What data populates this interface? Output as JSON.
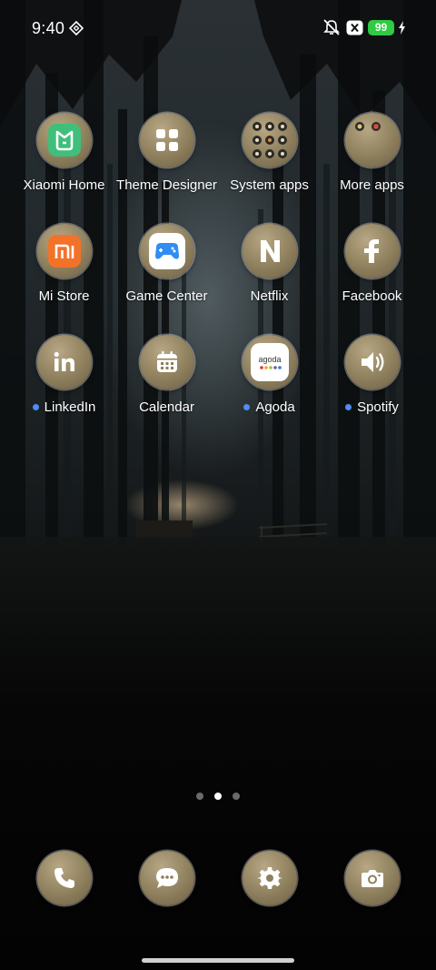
{
  "status_bar": {
    "time": "9:40",
    "battery_level": "99",
    "icons": [
      "vpn-diamond-icon",
      "mute-bell-icon",
      "close-box-icon",
      "charging-bolt-icon"
    ]
  },
  "apps_row1": [
    {
      "label": "Xiaomi Home",
      "icon": "mi-home-icon"
    },
    {
      "label": "Theme Designer",
      "icon": "grid-icon"
    },
    {
      "label": "System apps",
      "icon": "folder-icon"
    },
    {
      "label": "More apps",
      "icon": "folder-icon"
    }
  ],
  "apps_row2": [
    {
      "label": "Mi Store",
      "icon": "mi-logo-icon"
    },
    {
      "label": "Game Center",
      "icon": "gamepad-icon"
    },
    {
      "label": "Netflix",
      "icon": "netflix-n-icon"
    },
    {
      "label": "Facebook",
      "icon": "facebook-f-icon"
    }
  ],
  "apps_row3": [
    {
      "label": "LinkedIn",
      "icon": "linkedin-icon",
      "new_dot": true
    },
    {
      "label": "Calendar",
      "icon": "calendar-icon"
    },
    {
      "label": "Agoda",
      "icon": "agoda-icon",
      "new_dot": true,
      "logo_text": "agoda"
    },
    {
      "label": "Spotify",
      "icon": "speaker-icon",
      "new_dot": true
    }
  ],
  "pager": {
    "pages": 3,
    "current": 2
  },
  "dock": [
    {
      "name": "phone",
      "icon": "phone-icon"
    },
    {
      "name": "messages",
      "icon": "message-bubble-icon"
    },
    {
      "name": "settings",
      "icon": "gear-icon"
    },
    {
      "name": "camera",
      "icon": "camera-icon"
    }
  ],
  "colors": {
    "accent_dot": "#4f8cf6",
    "battery": "#2ecb43",
    "icon_bg": "#8e7f5d"
  }
}
